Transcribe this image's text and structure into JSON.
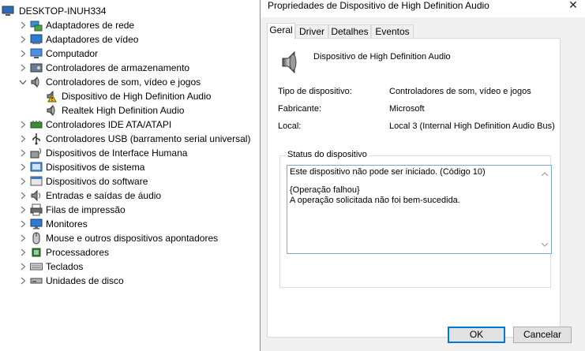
{
  "tree": {
    "root": "DESKTOP-INUH334",
    "items": [
      {
        "label": "Adaptadores de rede",
        "icon": "network-adapter-icon",
        "state": "collapsed"
      },
      {
        "label": "Adaptadores de vídeo",
        "icon": "display-adapter-icon",
        "state": "collapsed"
      },
      {
        "label": "Computador",
        "icon": "computer-icon",
        "state": "collapsed"
      },
      {
        "label": "Controladores de armazenamento",
        "icon": "storage-controller-icon",
        "state": "collapsed"
      },
      {
        "label": "Controladores de som, vídeo e jogos",
        "icon": "speaker-icon",
        "state": "expanded"
      },
      {
        "label": "Controladores IDE ATA/ATAPI",
        "icon": "ide-controller-icon",
        "state": "collapsed"
      },
      {
        "label": "Controladores USB (barramento serial universal)",
        "icon": "usb-icon",
        "state": "collapsed"
      },
      {
        "label": "Dispositivos de Interface Humana",
        "icon": "hid-icon",
        "state": "collapsed"
      },
      {
        "label": "Dispositivos de sistema",
        "icon": "system-device-icon",
        "state": "collapsed"
      },
      {
        "label": "Dispositivos do software",
        "icon": "software-device-icon",
        "state": "collapsed"
      },
      {
        "label": "Entradas e saídas de áudio",
        "icon": "audio-io-icon",
        "state": "collapsed"
      },
      {
        "label": "Filas de impressão",
        "icon": "printer-icon",
        "state": "collapsed"
      },
      {
        "label": "Monitores",
        "icon": "monitor-icon",
        "state": "collapsed"
      },
      {
        "label": "Mouse e outros dispositivos apontadores",
        "icon": "mouse-icon",
        "state": "collapsed"
      },
      {
        "label": "Processadores",
        "icon": "processor-icon",
        "state": "collapsed"
      },
      {
        "label": "Teclados",
        "icon": "keyboard-icon",
        "state": "collapsed"
      },
      {
        "label": "Unidades de disco",
        "icon": "disk-drive-icon",
        "state": "collapsed"
      }
    ],
    "sound_children": [
      {
        "label": "Dispositivo de High Definition Audio",
        "icon": "warning-speaker-icon"
      },
      {
        "label": "Realtek High Definition Audio",
        "icon": "speaker-icon"
      }
    ]
  },
  "dialog": {
    "title": "Propriedades de Dispositivo de High Definition Audio",
    "close_glyph": "✕",
    "tabs": [
      "Geral",
      "Driver",
      "Detalhes",
      "Eventos"
    ],
    "active_tab": "Geral",
    "device_name": "Dispositivo de High Definition Audio",
    "properties": [
      {
        "label": "Tipo de dispositivo:",
        "value": "Controladores de som, vídeo e jogos"
      },
      {
        "label": "Fabricante:",
        "value": "Microsoft"
      },
      {
        "label": "Local:",
        "value": "Local 3 (Internal High Definition Audio Bus)"
      }
    ],
    "status_group_label": "Status do dispositivo",
    "status_lines": [
      "Este dispositivo não pode ser iniciado. (Código 10)",
      "",
      "{Operação falhou}",
      "A operação solicitada não foi bem-sucedida."
    ],
    "ok_label": "OK",
    "cancel_label": "Cancelar"
  },
  "colors": {
    "focus_border": "#0078d7",
    "warning": "#f2c200"
  }
}
